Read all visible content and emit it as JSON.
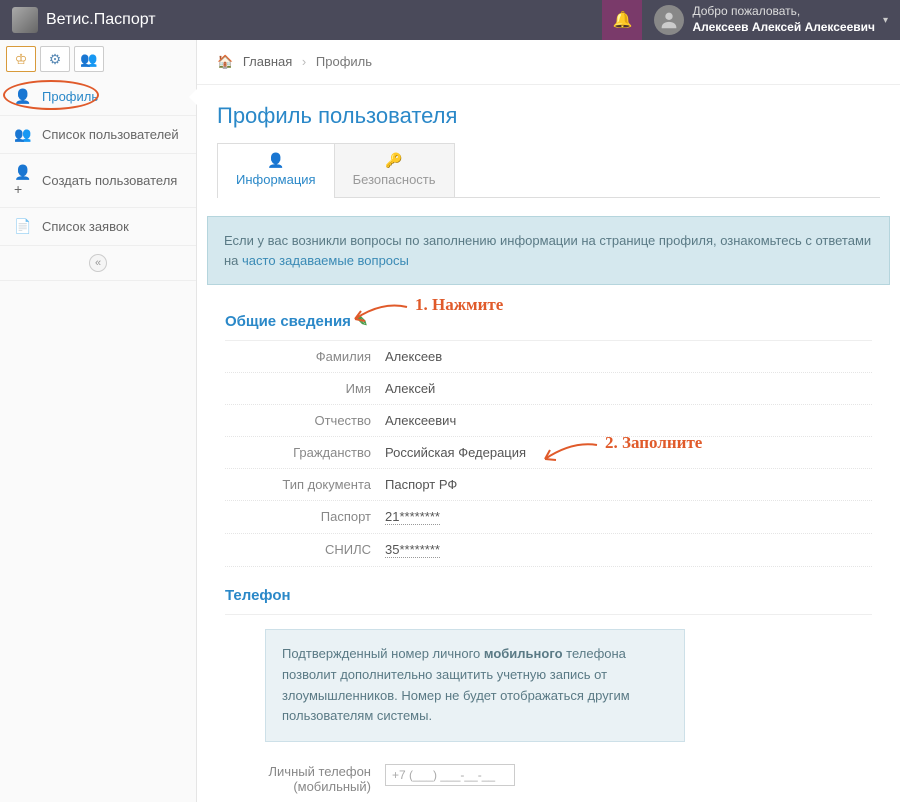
{
  "header": {
    "app_name": "Ветис.Паспорт",
    "welcome": "Добро пожаловать,",
    "user_fullname": "Алексеев Алексей Алексеевич"
  },
  "sidebar": {
    "items": [
      {
        "icon": "user-icon",
        "label": "Профиль"
      },
      {
        "icon": "users-icon",
        "label": "Список пользователей"
      },
      {
        "icon": "user-plus-icon",
        "label": "Создать пользователя"
      },
      {
        "icon": "file-icon",
        "label": "Список заявок"
      }
    ]
  },
  "breadcrumb": {
    "home": "Главная",
    "current": "Профиль"
  },
  "page_title": "Профиль пользователя",
  "tabs": {
    "info": "Информация",
    "security": "Безопасность"
  },
  "info_box": {
    "text": "Если у вас возникли вопросы по заполнению информации на странице профиля, ознакомьтесь с ответами на ",
    "link": "часто задаваемые вопросы"
  },
  "sections": {
    "general": "Общие сведения",
    "phone": "Телефон"
  },
  "fields": {
    "family_label": "Фамилия",
    "family_value": "Алексеев",
    "name_label": "Имя",
    "name_value": "Алексей",
    "patronymic_label": "Отчество",
    "patronymic_value": "Алексеевич",
    "citizenship_label": "Гражданство",
    "citizenship_value": "Российская Федерация",
    "doctype_label": "Тип документа",
    "doctype_value": "Паспорт РФ",
    "passport_label": "Паспорт",
    "passport_value": "21********",
    "snils_label": "СНИЛС",
    "snils_value": "35********"
  },
  "phone_notice": {
    "p1a": "Подтвержденный номер личного ",
    "p1b": "мобильного",
    "p1c": " телефона позволит дополнительно защитить учетную запись от злоумышленников. Номер не будет отображаться другим пользователям системы."
  },
  "phone_field": {
    "label1": "Личный телефон",
    "label2": "(мобильный)",
    "placeholder": "+7 (___) ___-__-__"
  },
  "annotations": {
    "step1": "1. Нажмите",
    "step2": "2. Заполните"
  }
}
